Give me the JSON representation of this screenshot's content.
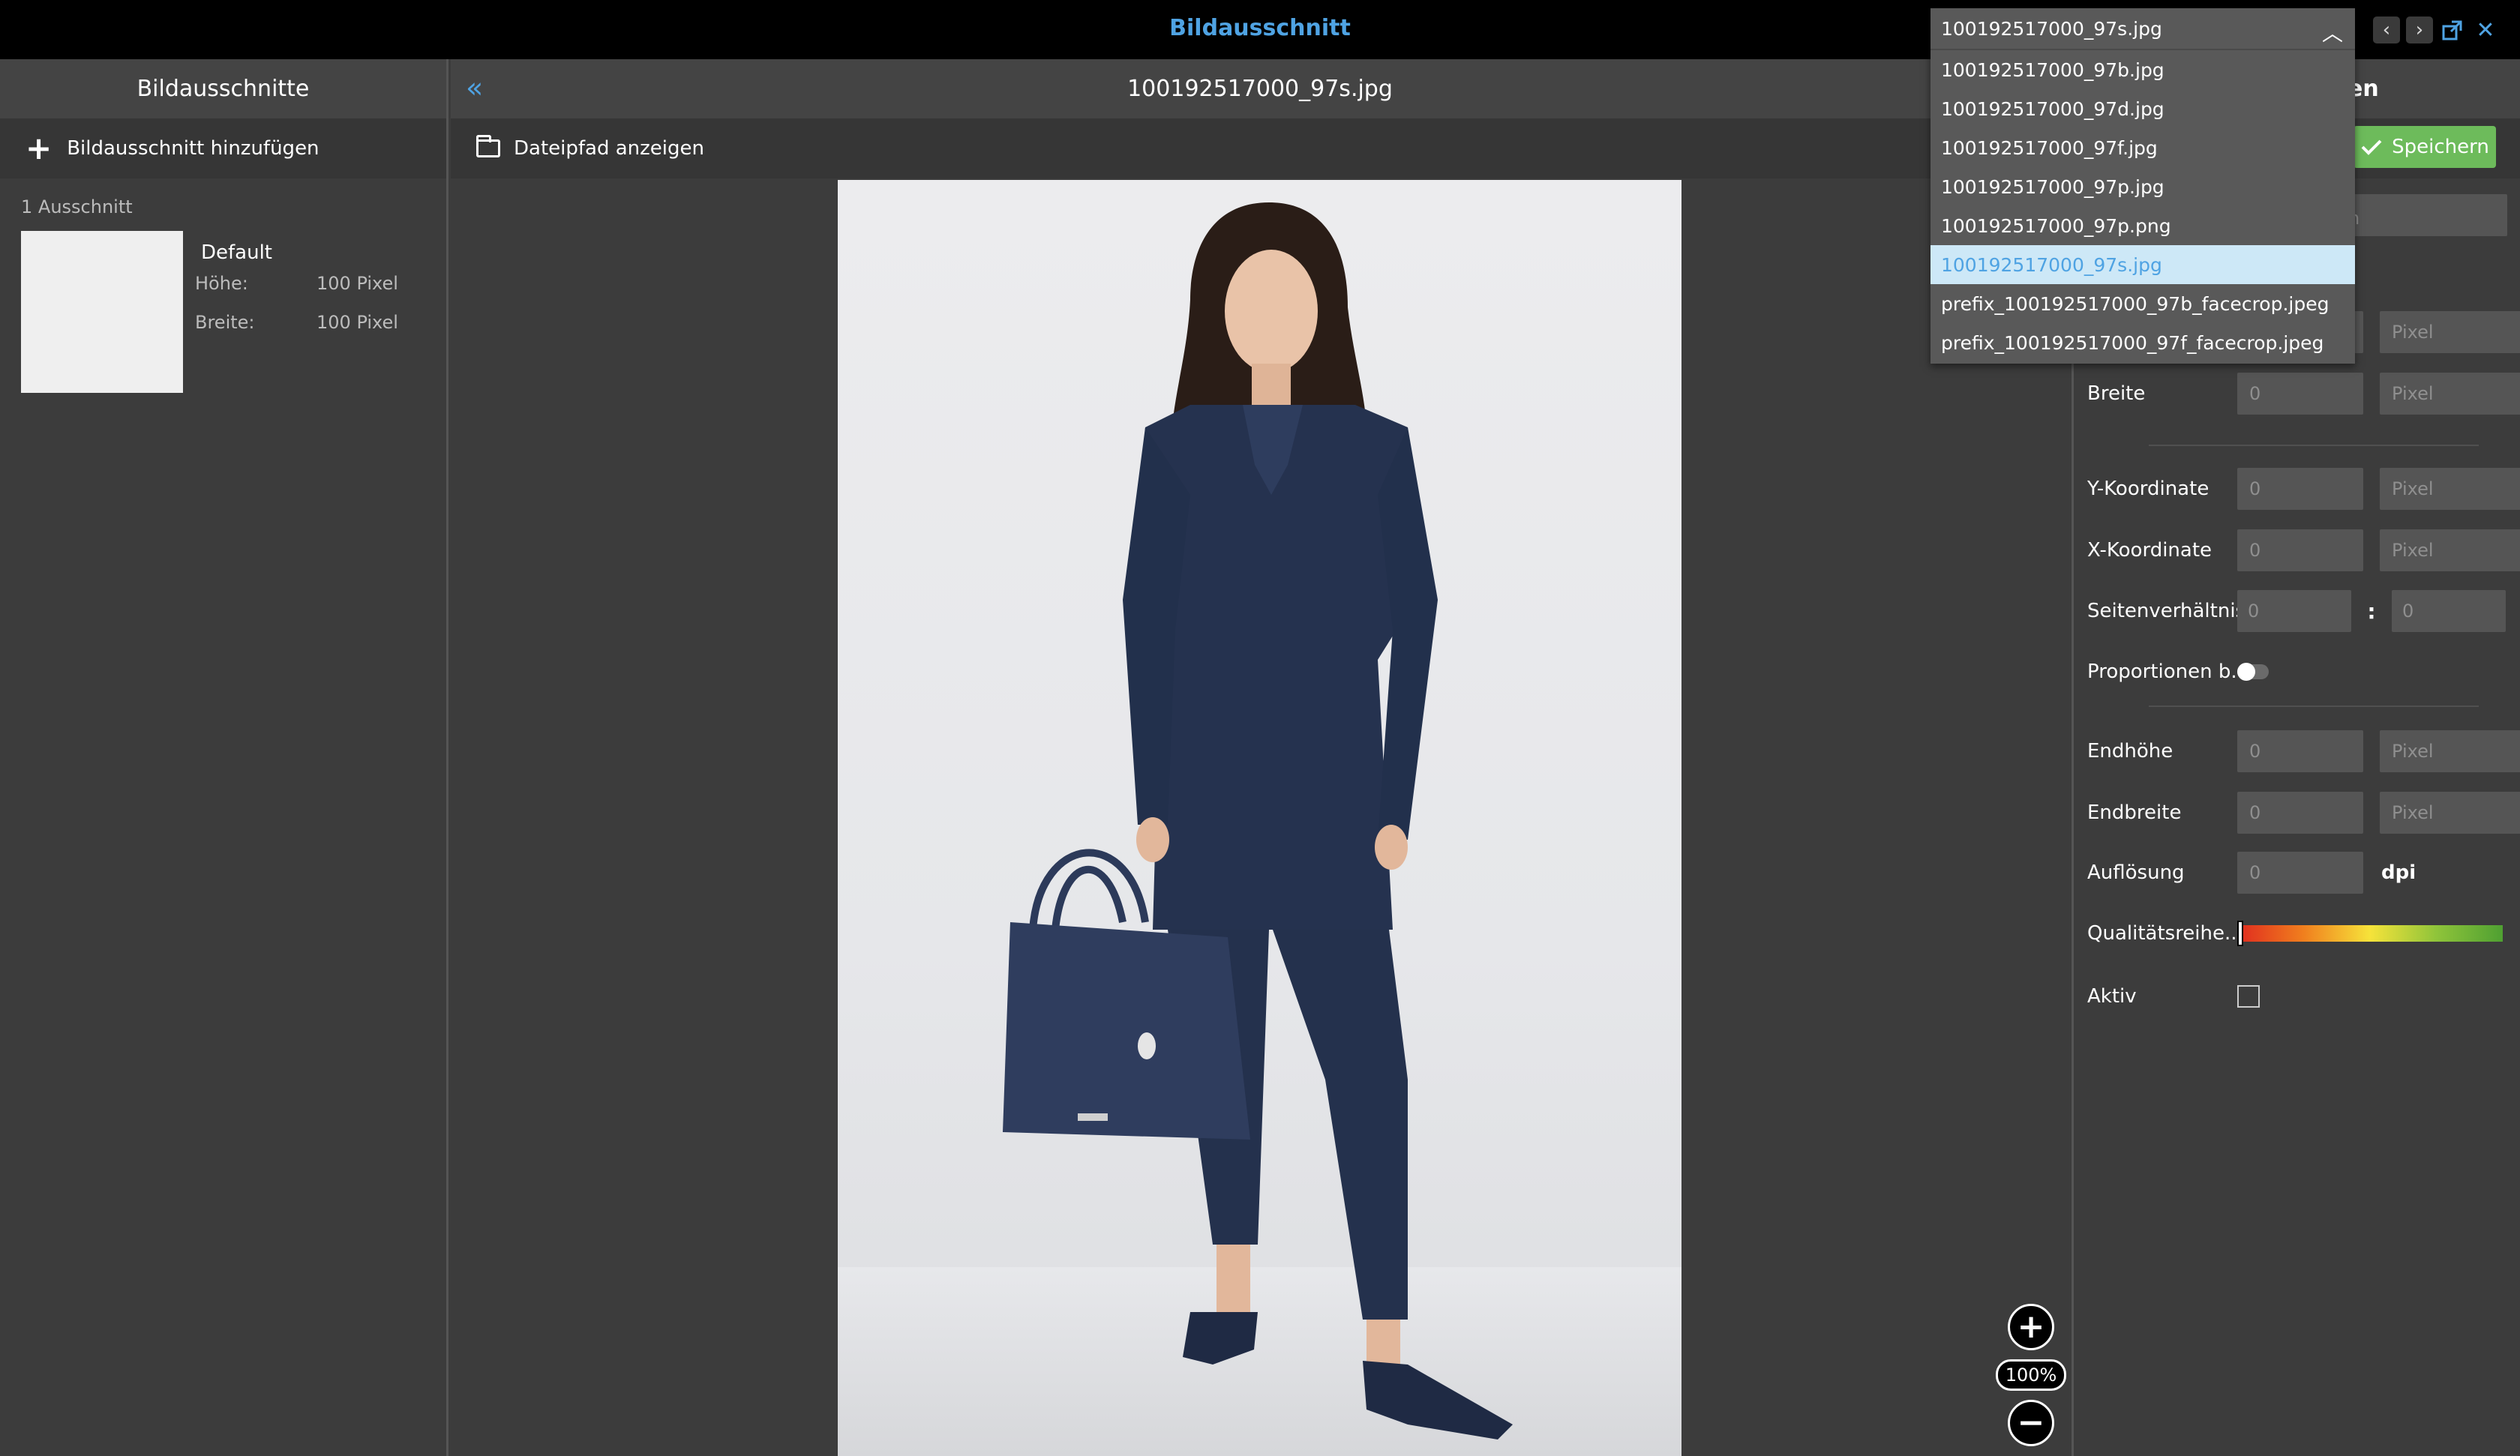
{
  "app": {
    "title": "Bildausschnitt"
  },
  "dropdown": {
    "selected": "100192517000_97s.jpg",
    "options": [
      "100192517000_97b.jpg",
      "100192517000_97d.jpg",
      "100192517000_97f.jpg",
      "100192517000_97p.jpg",
      "100192517000_97p.png",
      "100192517000_97s.jpg",
      "prefix_100192517000_97b_facecrop.jpeg",
      "prefix_100192517000_97f_facecrop.jpeg"
    ],
    "active_index": 5
  },
  "left_panel": {
    "title": "Bildausschnitte",
    "add_label": "Bildausschnitt hinzufügen",
    "count": "1 Ausschnitt",
    "crop": {
      "name": "Default",
      "height_label": "Höhe:",
      "height_value": "100 Pixel",
      "width_label": "Breite:",
      "width_value": "100 Pixel"
    }
  },
  "center_panel": {
    "title": "100192517000_97s.jpg",
    "show_path_label": "Dateipfad anzeigen",
    "zoom": "100%"
  },
  "right_panel": {
    "title_partial": "en",
    "save_label": "Speichern",
    "name_placeholder_partial": "ben",
    "fields": {
      "height_unit": "Pixel",
      "width_label": "Breite",
      "width_value": "0",
      "width_unit": "Pixel",
      "y_label": "Y-Koordinate",
      "y_value": "0",
      "y_unit": "Pixel",
      "x_label": "X-Koordinate",
      "x_value": "0",
      "x_unit": "Pixel",
      "ratio_label": "Seitenverhältnis",
      "ratio_a": "0",
      "ratio_sep": ":",
      "ratio_b": "0",
      "proportions_label": "Proportionen b...",
      "end_height_label": "Endhöhe",
      "end_height_value": "0",
      "end_height_unit": "Pixel",
      "end_width_label": "Endbreite",
      "end_width_value": "0",
      "end_width_unit": "Pixel",
      "resolution_label": "Auflösung",
      "resolution_value": "0",
      "resolution_unit": "dpi",
      "quality_label": "Qualitätsreihe...",
      "active_label": "Aktiv"
    }
  },
  "colors": {
    "accent": "#4fa3e3",
    "save": "#6dbb5b",
    "suit": "#25324f"
  }
}
